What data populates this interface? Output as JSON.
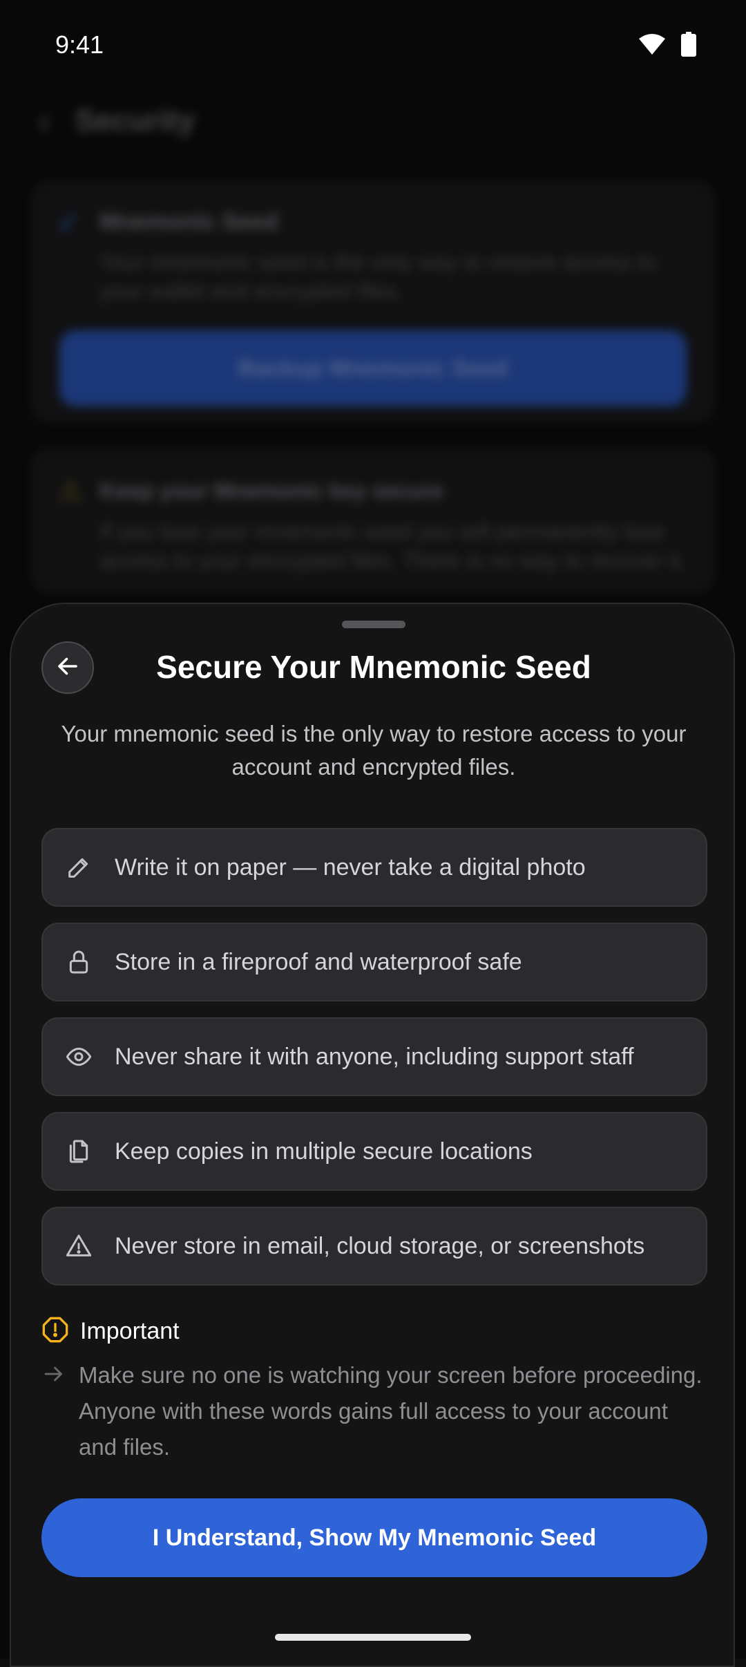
{
  "status_bar": {
    "time": "9:41"
  },
  "background": {
    "header_title": "Security",
    "seed_card": {
      "title": "Mnemonic Seed",
      "description": "Your mnemonic seed is the only way to restore access to your wallet and encrypted files.",
      "button_label": "Backup Mnemonic Seed"
    },
    "warning_card": {
      "title": "Keep your Mnemonic key secure",
      "description": "If you lose your mnemonic seed you will permanently lose access to your encrypted files. There is no way to recover it."
    }
  },
  "sheet": {
    "title": "Secure Your Mnemonic Seed",
    "subtitle": "Your mnemonic seed is the only way to restore access to your account and encrypted files.",
    "tips": [
      {
        "icon": "pencil-icon",
        "text": "Write it on paper — never take a digital photo"
      },
      {
        "icon": "lock-icon",
        "text": "Store in a fireproof and waterproof safe"
      },
      {
        "icon": "eye-icon",
        "text": "Never share it with anyone, including support staff"
      },
      {
        "icon": "copy-icon",
        "text": "Keep copies in multiple secure locations"
      },
      {
        "icon": "warning-triangle-icon",
        "text": "Never store in email, cloud storage, or screenshots"
      }
    ],
    "important_label": "Important",
    "important_text": "Make sure no one is watching your screen before proceeding. Anyone with these words gains full access to your account and files.",
    "cta_label": "I Understand, Show My Mnemonic Seed"
  },
  "colors": {
    "accent": "#2f64d8",
    "warning": "#f5b31a",
    "sheet_bg": "#141415",
    "tip_bg": "#2b2b2d"
  }
}
